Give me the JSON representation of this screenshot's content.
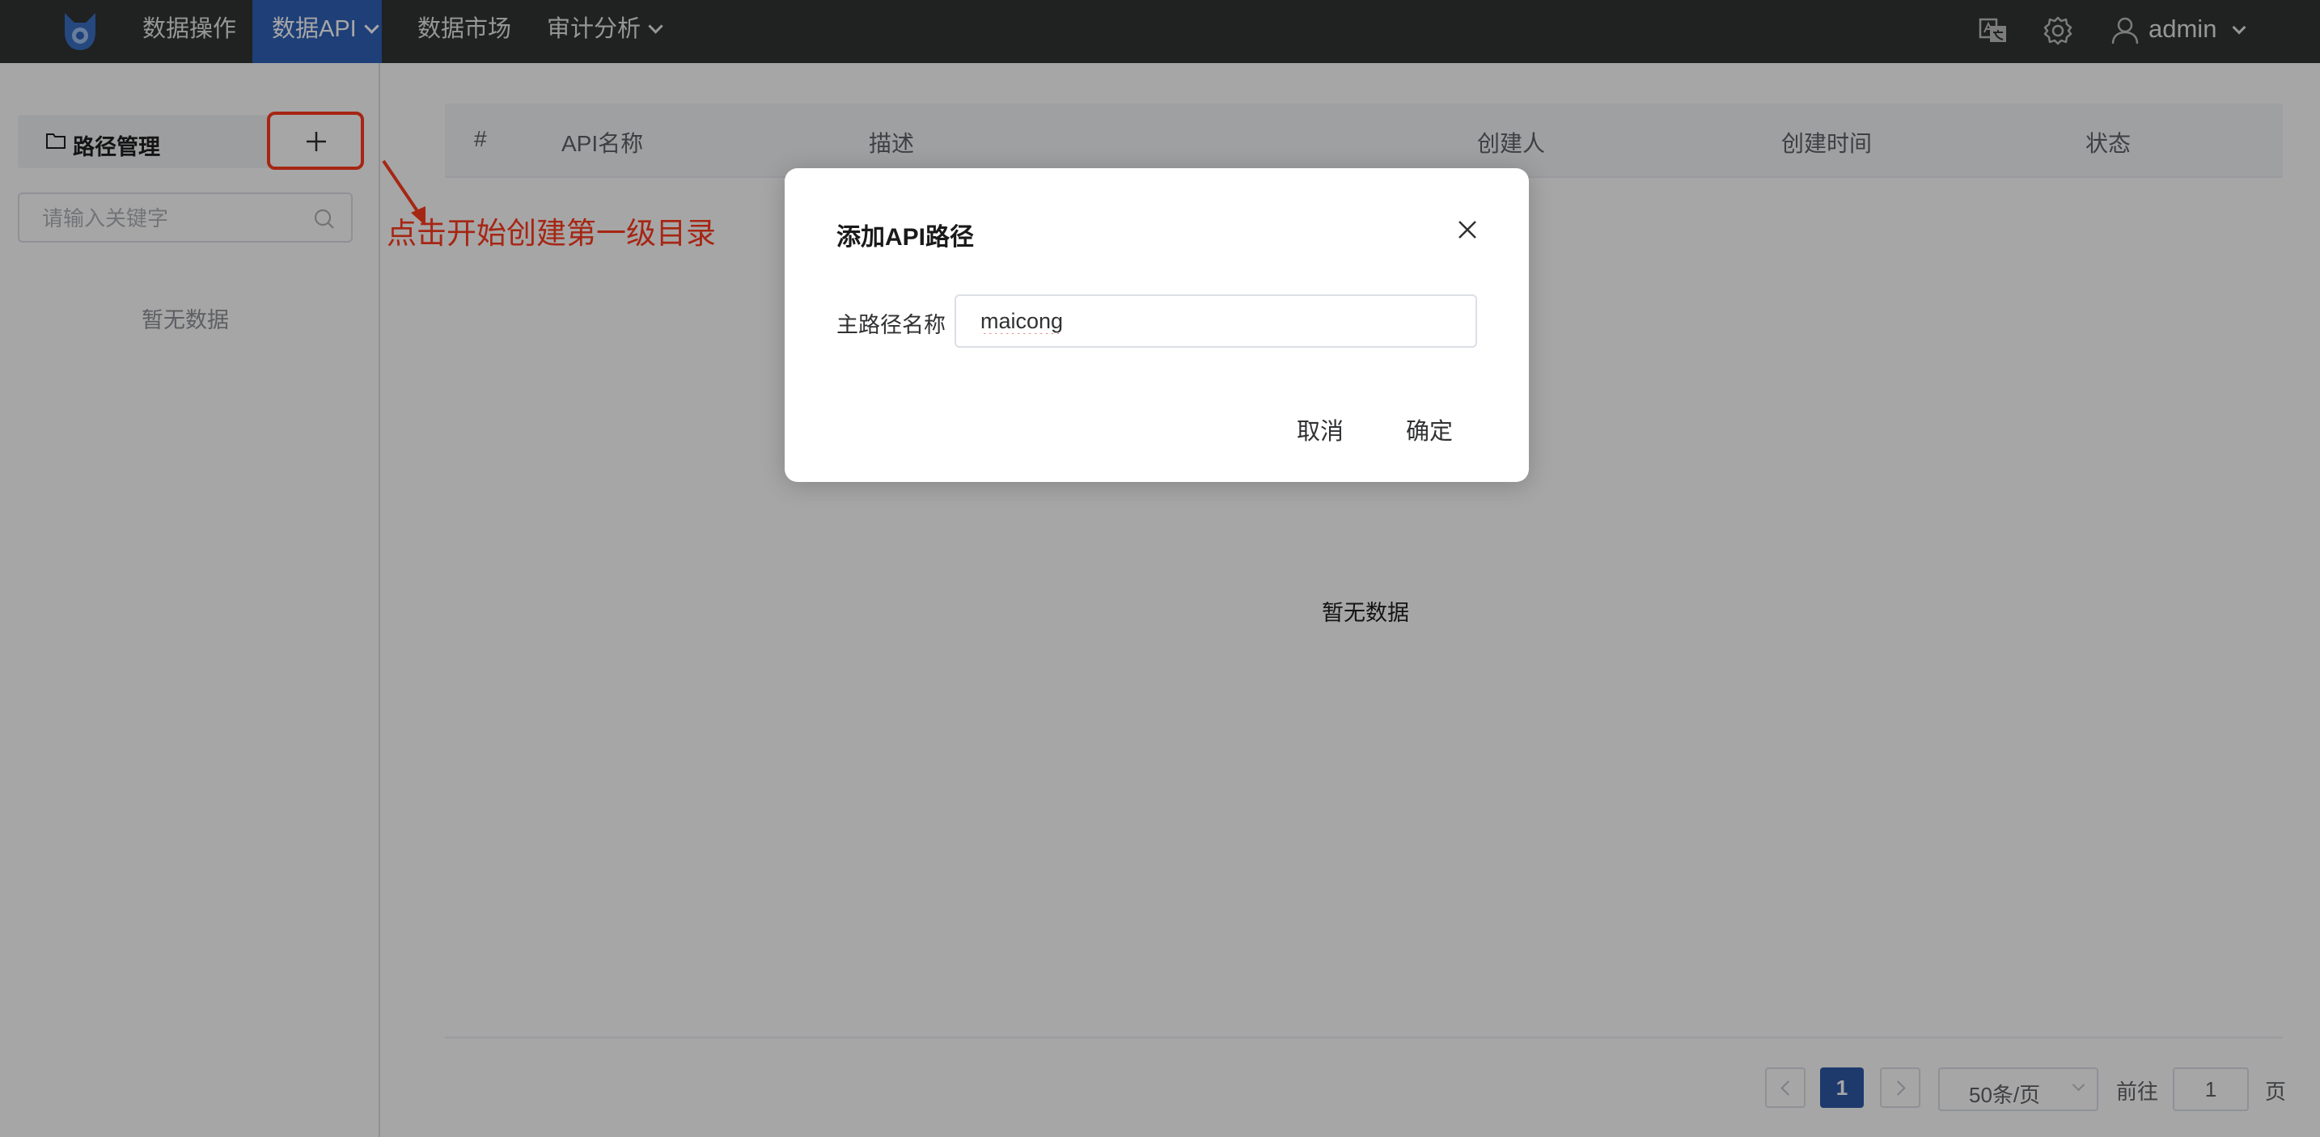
{
  "nav": {
    "items": [
      {
        "label": "数据操作",
        "has_caret": false
      },
      {
        "label": "数据API",
        "has_caret": true,
        "active": true
      },
      {
        "label": "数据市场",
        "has_caret": false
      },
      {
        "label": "审计分析",
        "has_caret": true
      }
    ],
    "icons": [
      "translate-icon",
      "settings-gear-icon",
      "user-icon"
    ],
    "user_name": "admin"
  },
  "sidebar": {
    "path_title": "路径管理",
    "search_placeholder": "请输入关键字",
    "empty_text": "暂无数据"
  },
  "annotation": {
    "text": "点击开始创建第一级目录",
    "color": "#ff3b1f"
  },
  "table": {
    "columns": [
      "#",
      "API名称",
      "描述",
      "创建人",
      "创建时间",
      "状态"
    ],
    "empty_text": "暂无数据"
  },
  "pagination": {
    "current_page": "1",
    "page_size": "50条/页",
    "goto_label": "前往",
    "goto_value": "1",
    "page_unit": "页"
  },
  "dialog": {
    "title": "添加API路径",
    "field_label": "主路径名称",
    "field_value": "maicong",
    "cancel_label": "取消",
    "confirm_label": "确定"
  },
  "colors": {
    "topbar": "#323333",
    "nav_active": "#2f62b8",
    "pagination_active": "#2f5aa8",
    "highlight": "#ff3b1f"
  }
}
